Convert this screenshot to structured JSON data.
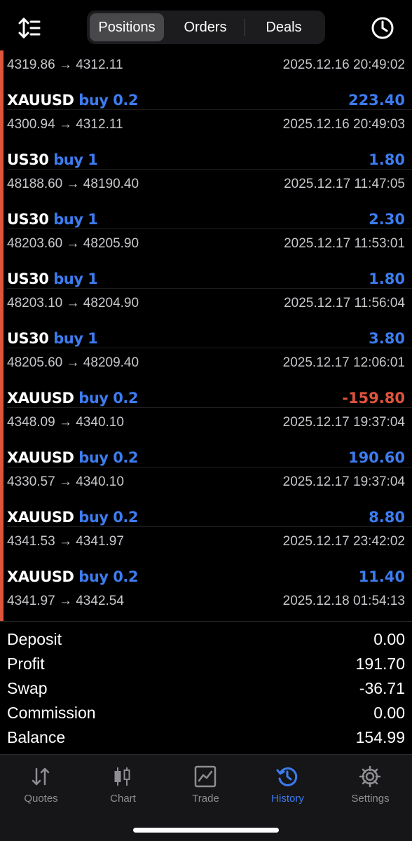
{
  "header": {
    "tabs": [
      {
        "label": "Positions",
        "active": true
      },
      {
        "label": "Orders",
        "active": false
      },
      {
        "label": "Deals",
        "active": false
      }
    ],
    "sort_icon": "sort-icon",
    "clock_icon": "clock-icon"
  },
  "deals": [
    {
      "symbol": "",
      "side": "",
      "profit": "",
      "prices": "4319.86 → 4312.11",
      "time": "2025.12.16 20:49:02",
      "negative": false
    },
    {
      "symbol": "XAUUSD",
      "side": "buy 0.2",
      "profit": "223.40",
      "prices": "4300.94 → 4312.11",
      "time": "2025.12.16 20:49:03",
      "negative": false
    },
    {
      "symbol": "US30",
      "side": "buy 1",
      "profit": "1.80",
      "prices": "48188.60 → 48190.40",
      "time": "2025.12.17 11:47:05",
      "negative": false
    },
    {
      "symbol": "US30",
      "side": "buy 1",
      "profit": "2.30",
      "prices": "48203.60 → 48205.90",
      "time": "2025.12.17 11:53:01",
      "negative": false
    },
    {
      "symbol": "US30",
      "side": "buy 1",
      "profit": "1.80",
      "prices": "48203.10 → 48204.90",
      "time": "2025.12.17 11:56:04",
      "negative": false
    },
    {
      "symbol": "US30",
      "side": "buy 1",
      "profit": "3.80",
      "prices": "48205.60 → 48209.40",
      "time": "2025.12.17 12:06:01",
      "negative": false
    },
    {
      "symbol": "XAUUSD",
      "side": "buy 0.2",
      "profit": "-159.80",
      "prices": "4348.09 → 4340.10",
      "time": "2025.12.17 19:37:04",
      "negative": true
    },
    {
      "symbol": "XAUUSD",
      "side": "buy 0.2",
      "profit": "190.60",
      "prices": "4330.57 → 4340.10",
      "time": "2025.12.17 19:37:04",
      "negative": false
    },
    {
      "symbol": "XAUUSD",
      "side": "buy 0.2",
      "profit": "8.80",
      "prices": "4341.53 → 4341.97",
      "time": "2025.12.17 23:42:02",
      "negative": false
    },
    {
      "symbol": "XAUUSD",
      "side": "buy 0.2",
      "profit": "11.40",
      "prices": "4341.97 → 4342.54",
      "time": "2025.12.18 01:54:13",
      "negative": false
    }
  ],
  "summary": [
    {
      "label": "Deposit",
      "value": "0.00"
    },
    {
      "label": "Profit",
      "value": "191.70"
    },
    {
      "label": "Swap",
      "value": "-36.71"
    },
    {
      "label": "Commission",
      "value": "0.00"
    },
    {
      "label": "Balance",
      "value": "154.99"
    }
  ],
  "tabbar": [
    {
      "label": "Quotes",
      "icon": "quotes-icon",
      "active": false
    },
    {
      "label": "Chart",
      "icon": "chart-icon",
      "active": false
    },
    {
      "label": "Trade",
      "icon": "trade-icon",
      "active": false
    },
    {
      "label": "History",
      "icon": "history-icon",
      "active": true
    },
    {
      "label": "Settings",
      "icon": "settings-icon",
      "active": false
    }
  ],
  "colors": {
    "accent_blue": "#3c7cf0",
    "loss_red": "#e0543c",
    "background": "#000000"
  }
}
